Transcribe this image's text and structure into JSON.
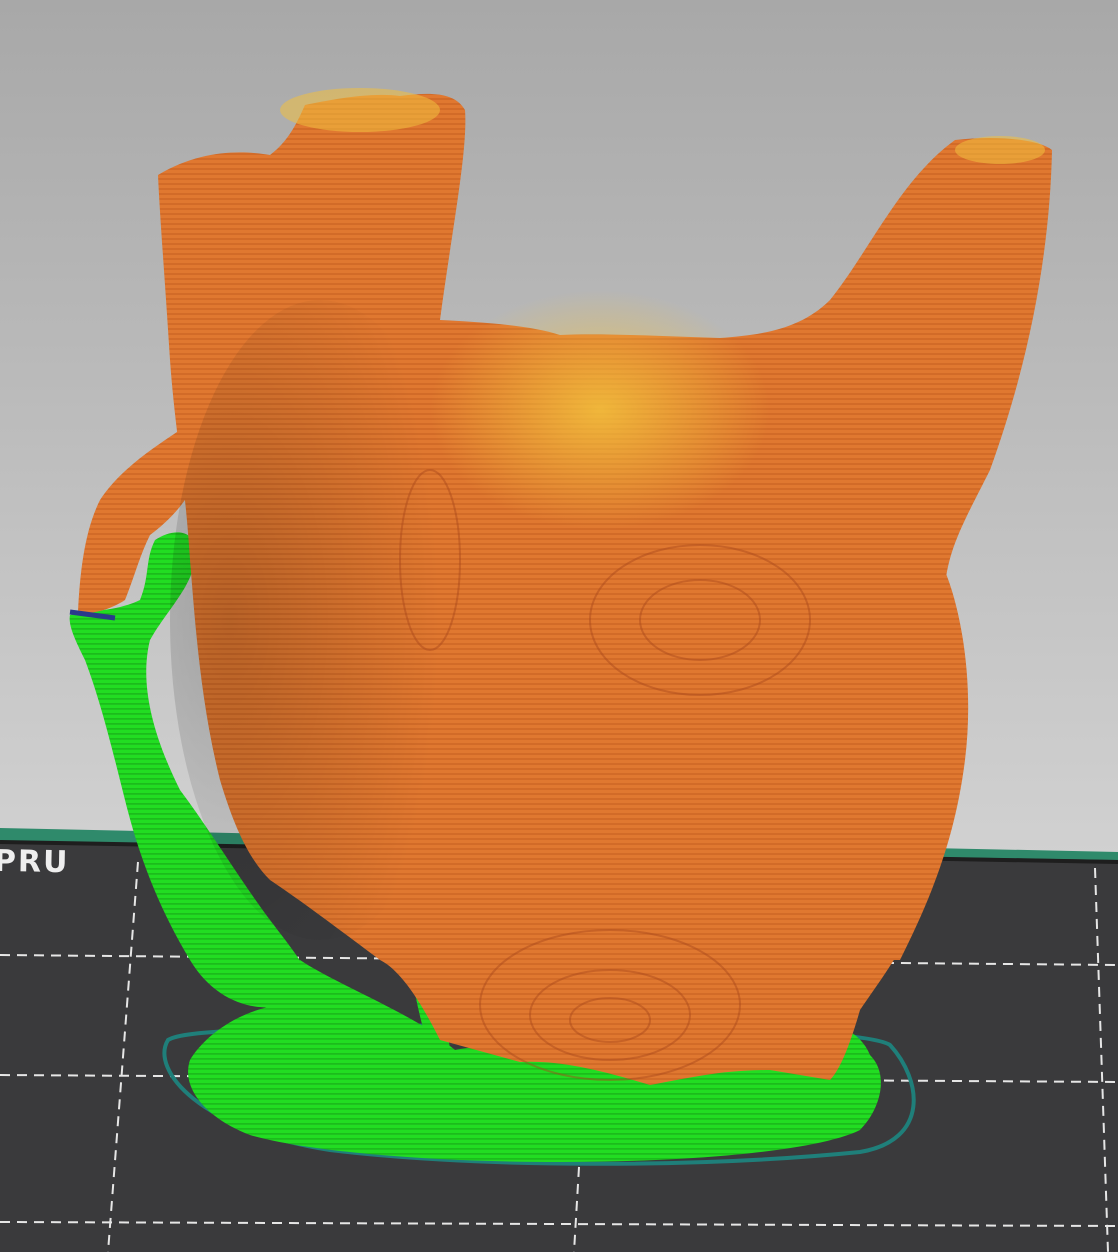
{
  "viewport": {
    "background_top": "#a8a8a8",
    "background_bottom": "#d2d2d2",
    "bed": {
      "label": "PRU",
      "surface_color": "#3a3a3c",
      "edge_color": "#2f8a6b",
      "grid_color": "#e6e6e6"
    },
    "model": {
      "perimeter_color": "#e07830",
      "top_shade_color": "#f0c040",
      "support_color": "#22dd22",
      "skirt_color": "#1f7f7a"
    }
  }
}
